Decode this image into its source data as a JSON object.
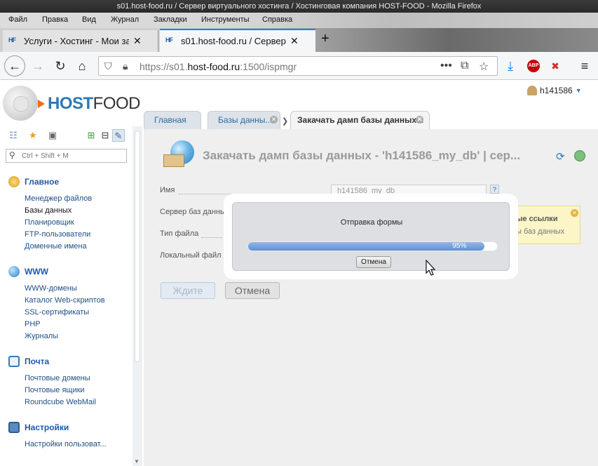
{
  "window": {
    "title": "s01.host-food.ru / Сервер виртуального хостинга / Хостинговая компания HOST-FOOD - Mozilla Firefox"
  },
  "menu": [
    "Файл",
    "Правка",
    "Вид",
    "Журнал",
    "Закладки",
    "Инструменты",
    "Справка"
  ],
  "browser_tabs": [
    {
      "label": "Услуги - Хостинг - Мои за"
    },
    {
      "label": "s01.host-food.ru / Сервер в"
    }
  ],
  "toolbar": {
    "url_scheme": "https://s01.",
    "url_host": "host-food.ru",
    "url_rest": ":1500/ispmgr",
    "abp_label": "ABP"
  },
  "logo": {
    "part1": "HOST",
    "part2": "FOOD"
  },
  "user": {
    "name": "h141586"
  },
  "page_tabs": [
    {
      "label": "Главная"
    },
    {
      "label": "Базы данны..."
    },
    {
      "label": "Закачать дамп базы данных..."
    }
  ],
  "sidebar": {
    "search_placeholder": "Ctrl + Shift + M",
    "groups": [
      {
        "title": "Главное",
        "items": [
          "Менеджер файлов",
          "Базы данных",
          "Планировщик",
          "FTP-пользователи",
          "Доменные имена"
        ]
      },
      {
        "title": "WWW",
        "items": [
          "WWW-домены",
          "Каталог Web-скриптов",
          "SSL-сертификаты",
          "PHP",
          "Журналы"
        ]
      },
      {
        "title": "Почта",
        "items": [
          "Почтовые домены",
          "Почтовые ящики",
          "Roundcube WebMail"
        ]
      },
      {
        "title": "Настройки",
        "items": [
          "Настройки пользоват..."
        ]
      }
    ]
  },
  "form": {
    "title": "Закачать дамп базы данных - 'h141586_my_db' | сер...",
    "labels": [
      "Имя",
      "Сервер баз данны",
      "Тип файла",
      "Локальный файл"
    ],
    "name_value": "h141586_my_db",
    "help_mark": "?",
    "wait_button": "Ждите",
    "cancel_button": "Отмена"
  },
  "hint": {
    "line1": "ые ссылки",
    "line2": "ы баз данных"
  },
  "dialog": {
    "title": "Отправка формы",
    "progress_percent": 95,
    "progress_label": "95%",
    "cancel_label": "Отмена"
  }
}
